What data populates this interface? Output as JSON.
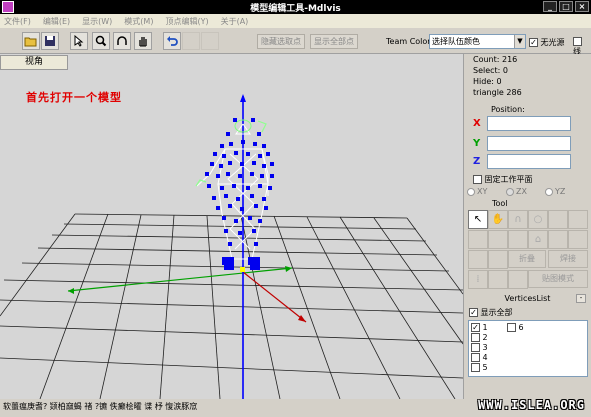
{
  "window": {
    "title": "模型编辑工具-Mdlvis"
  },
  "menu": [
    "文件(F)",
    "编辑(E)",
    "显示(W)",
    "模式(M)",
    "顶点编辑(Y)",
    "关于(A)"
  ],
  "toolbar": {
    "hide_selected_label": "隐藏选取点",
    "show_all_label": "显示全部点",
    "team_color_label": "Team Color",
    "team_color_value": "选择队伍颜色",
    "no_light_label": "无光源",
    "cut_label": "线"
  },
  "viewport": {
    "view_button": "视角",
    "hint": "首先打开一个模型"
  },
  "stats": {
    "count": "Count: 216",
    "select": "Select: 0",
    "hide": "Hide: 0",
    "triangle": "triangle 286"
  },
  "position": {
    "label": "Position:",
    "x": "X",
    "y": "Y",
    "z": "Z"
  },
  "work_plane": {
    "label": "固定工作平面",
    "options": [
      "XY",
      "ZX",
      "YZ"
    ]
  },
  "tool": {
    "label": "Tool",
    "fold_label": "折叠",
    "weld_label": "焊接",
    "map_mode_label": "贴图模式"
  },
  "vertices_list": {
    "title": "VerticesList",
    "show_all": "显示全部",
    "items": [
      "1",
      "2",
      "3",
      "4",
      "5",
      "6"
    ]
  },
  "statusbar": {
    "text": "软蠆瘟庚耆? 颎柏窳蝎 禇    ?镳 佚癫桧曤 谍     杼 愎涙豚窊"
  },
  "watermark": "WWW.ISLEA.ORG",
  "colors": {
    "accent_red": "#e00000",
    "axis_blue": "#0000ff",
    "axis_green": "#00a000",
    "vertex_blue": "#0000ee"
  }
}
